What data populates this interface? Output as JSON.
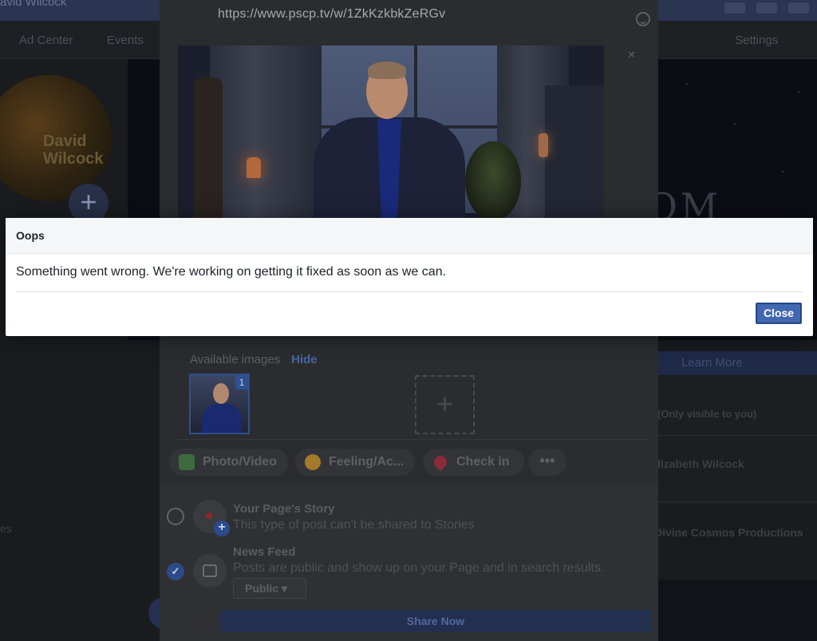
{
  "background": {
    "page_name": "avid Wilcock",
    "tabs": [
      "Ad Center",
      "Events",
      "Settings"
    ],
    "avatar_text": "David Wilcock",
    "cover_text": "OM",
    "learn_more": "Learn More",
    "right_items": [
      "(Only visible to you)",
      "lizabeth Wilcock",
      "Divine Cosmos Productions"
    ],
    "left_fragment": "es"
  },
  "share_dialog": {
    "url": "https://www.pscp.tv/w/1ZkKzkbkZeRGv",
    "available_images_label": "Available images",
    "hide_label": "Hide",
    "thumb_count": "1",
    "actions": [
      {
        "label": "Photo/Video",
        "icon": "photo-icon",
        "color": "#3d6b3f"
      },
      {
        "label": "Feeling/Ac...",
        "icon": "smiley-icon",
        "color": "#a37a2a"
      },
      {
        "label": "Check in",
        "icon": "location-pin-icon",
        "color": "#8a2a3a"
      }
    ],
    "more_label": "•••",
    "destinations": [
      {
        "title": "Your Page's Story",
        "subtitle": "This type of post can't be shared to Stories",
        "selected": false
      },
      {
        "title": "News Feed",
        "subtitle": "Posts are public and show up on your Page and in search results.",
        "selected": true
      }
    ],
    "privacy": "Public ▾",
    "share_button": "Share Now"
  },
  "error_dialog": {
    "title": "Oops",
    "message": "Something went wrong. We're working on getting it fixed as soon as we can.",
    "close_label": "Close",
    "accent_color": "#4267b2"
  }
}
